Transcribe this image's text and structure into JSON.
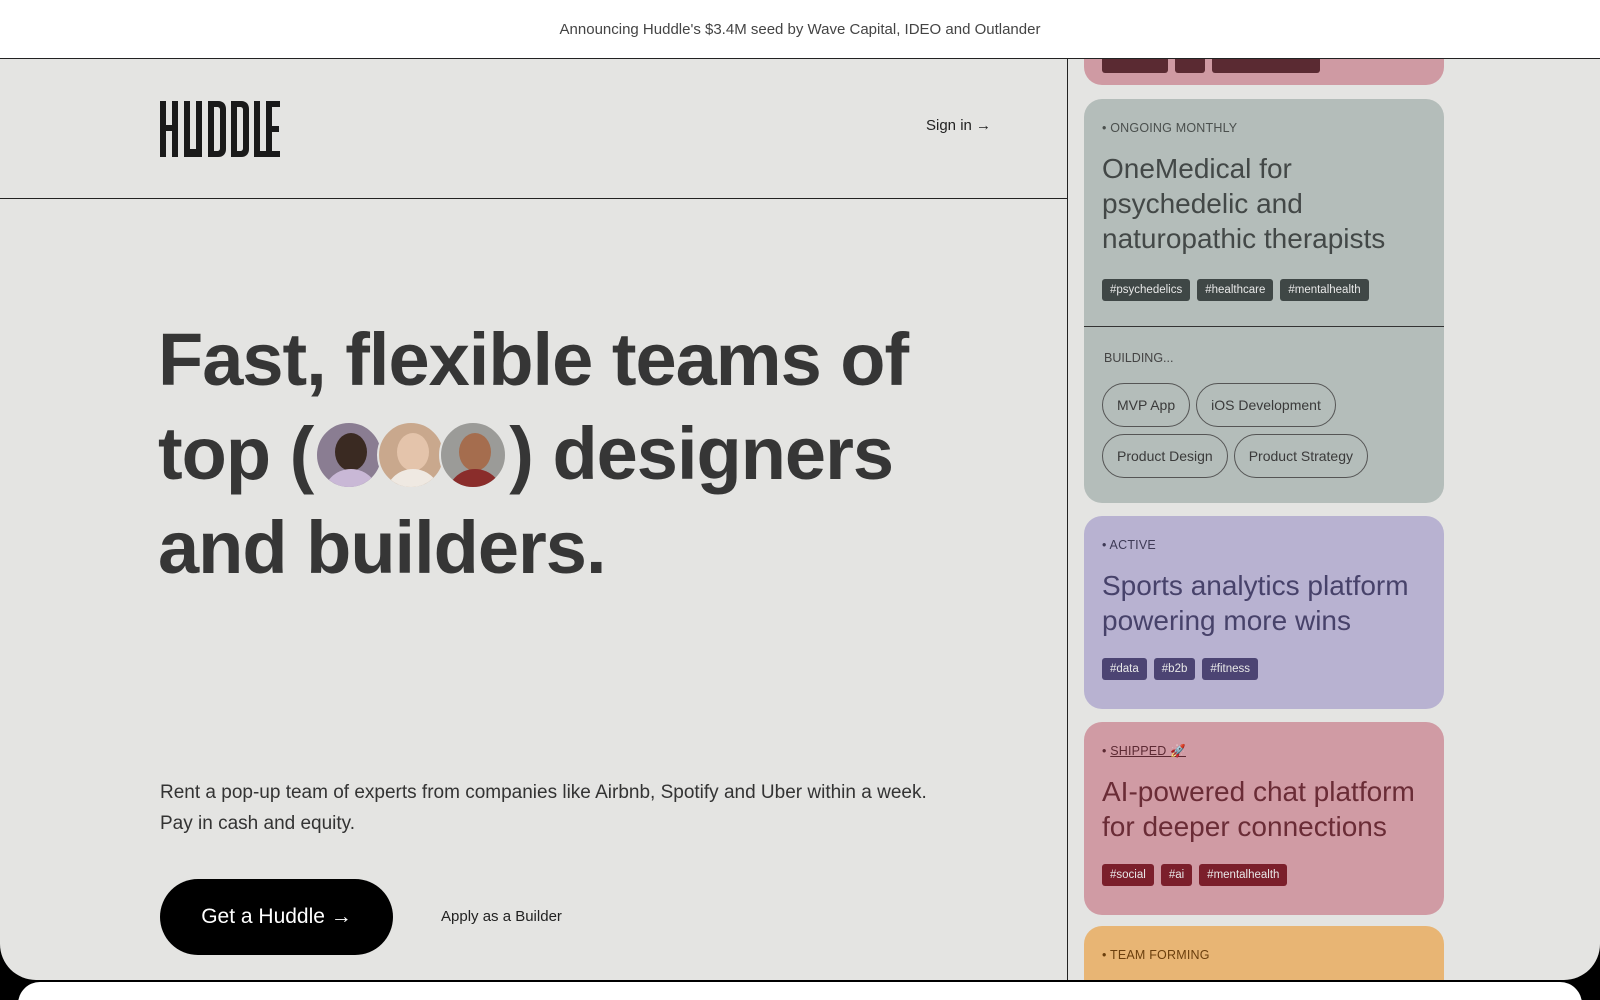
{
  "announcement": "Announcing Huddle's $3.4M seed by Wave Capital, IDEO and Outlander",
  "nav": {
    "logo": "HUDDLE",
    "signin": "Sign in →"
  },
  "hero": {
    "line1": "Fast, flexible teams of",
    "line2_before": "top (",
    "line2_after": ") designers",
    "line3": "and builders."
  },
  "description": {
    "line1": "Rent a pop-up team of experts from companies like Airbnb, Spotify and Uber within a week.",
    "line2": "Pay in cash and equity."
  },
  "cta": {
    "primary": "Get a Huddle →",
    "secondary": "Apply as a Builder"
  },
  "cards": {
    "medical": {
      "status": "• ONGOING MONTHLY",
      "title": "OneMedical for psychedelic and naturopathic therapists",
      "tags": [
        "#psychedelics",
        "#healthcare",
        "#mentalhealth"
      ],
      "building_label": "BUILDING...",
      "chips": [
        "MVP App",
        "iOS Development",
        "Product Design",
        "Product Strategy"
      ]
    },
    "sports": {
      "status": "• ACTIVE",
      "title": "Sports analytics platform powering more wins",
      "tags": [
        "#data",
        "#b2b",
        "#fitness"
      ]
    },
    "ai": {
      "status_bullet": "• ",
      "status_link": "SHIPPED 🚀",
      "title": "AI-powered chat platform for deeper connections",
      "tags": [
        "#social",
        "#ai",
        "#mentalhealth"
      ]
    },
    "team": {
      "status": "• TEAM FORMING"
    }
  }
}
